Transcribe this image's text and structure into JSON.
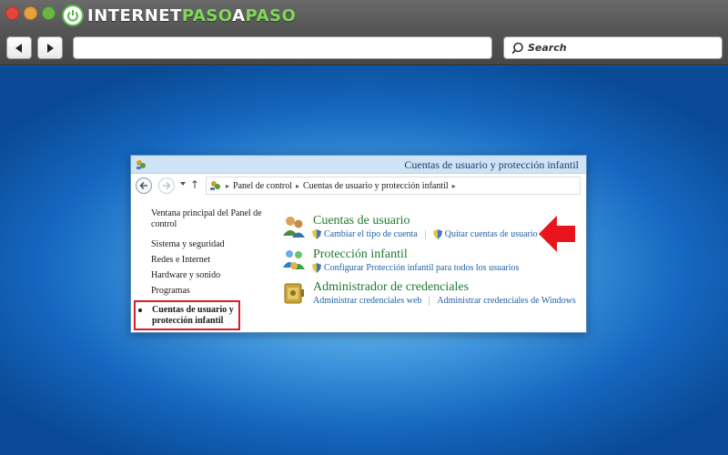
{
  "browser": {
    "logo": {
      "part1": "INTERNET",
      "part2": "PASO",
      "part3": "A",
      "part4": "PASO"
    },
    "search": {
      "placeholder": "Search"
    },
    "colors": {
      "chrome": "#555555",
      "logo_accent": "#7ed957"
    }
  },
  "window": {
    "title": "Cuentas de usuario y protección infantil",
    "breadcrumb": [
      "Panel de control",
      "Cuentas de usuario y protección infantil"
    ]
  },
  "sidebar": {
    "items": [
      {
        "label": "Ventana principal del Panel de control"
      },
      {
        "label": "Sistema y seguridad"
      },
      {
        "label": "Redes e Internet"
      },
      {
        "label": "Hardware y sonido"
      },
      {
        "label": "Programas"
      }
    ],
    "current": {
      "line1": "Cuentas de usuario y",
      "line2": "protección infantil"
    }
  },
  "categories": [
    {
      "title": "Cuentas de usuario",
      "icon": "users-icon",
      "links": [
        "Cambiar el tipo de cuenta",
        "Quitar cuentas de usuario"
      ]
    },
    {
      "title": "Protección infantil",
      "icon": "family-safety-icon",
      "links": [
        "Configurar Protección infantil para todos los usuarios"
      ]
    },
    {
      "title": "Administrador de credenciales",
      "icon": "credential-vault-icon",
      "links": [
        "Administrar credenciales web",
        "Administrar credenciales de Windows"
      ]
    }
  ],
  "annotations": {
    "highlight_color": "#d0202a",
    "arrow_color": "#e8141e"
  }
}
